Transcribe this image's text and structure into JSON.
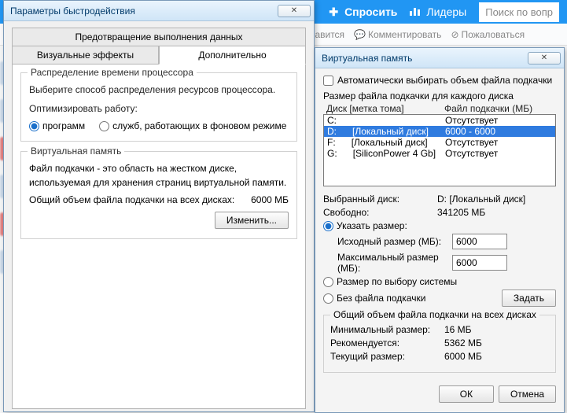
{
  "browser": {
    "ask": "Спросить",
    "leaders": "Лидеры",
    "search_placeholder": "Поиск по вопр"
  },
  "actions": {
    "like": "равится",
    "comment": "Комментировать",
    "report": "Пожаловаться"
  },
  "perf": {
    "title": "Параметры быстродействия",
    "tab_dep": "Предотвращение выполнения данных",
    "tab_vis": "Визуальные эффекты",
    "tab_adv": "Дополнительно",
    "cpu_group": "Распределение времени процессора",
    "cpu_desc": "Выберите способ распределения ресурсов процессора.",
    "opt_label": "Оптимизировать работу:",
    "radio_programs": "программ",
    "radio_services": "служб, работающих в фоновом режиме",
    "vm_group": "Виртуальная память",
    "vm_desc1": "Файл подкачки - это область на жестком диске,",
    "vm_desc2": "используемая для хранения страниц виртуальной памяти.",
    "vm_total_label": "Общий объем файла подкачки на всех дисках:",
    "vm_total_value": "6000 МБ",
    "change_btn": "Изменить..."
  },
  "vm": {
    "title": "Виртуальная память",
    "auto_chk": "Автоматически выбирать объем файла подкачки",
    "per_drive_label": "Размер файла подкачки для каждого диска",
    "col_drive": "Диск [метка тома]",
    "col_pf": "Файл подкачки (МБ)",
    "drives": [
      {
        "letter": "C:",
        "label": "",
        "pf": "Отсутствует",
        "selected": false
      },
      {
        "letter": "D:",
        "label": "[Локальный диск]",
        "pf": "6000 - 6000",
        "selected": true
      },
      {
        "letter": "F:",
        "label": "[Локальный диск]",
        "pf": "Отсутствует",
        "selected": false
      },
      {
        "letter": "G:",
        "label": "[SiliconPower 4 Gb]",
        "pf": "Отсутствует",
        "selected": false
      }
    ],
    "sel_drive_label": "Выбранный диск:",
    "sel_drive_value": "D:   [Локальный диск]",
    "free_label": "Свободно:",
    "free_value": "341205 МБ",
    "radio_custom": "Указать размер:",
    "init_label": "Исходный размер (МБ):",
    "init_value": "6000",
    "max_label": "Максимальный размер (МБ):",
    "max_value": "6000",
    "radio_system": "Размер по выбору системы",
    "radio_none": "Без файла подкачки",
    "set_btn": "Задать",
    "total_group": "Общий объем файла подкачки на всех дисках",
    "min_label": "Минимальный размер:",
    "min_value": "16 МБ",
    "rec_label": "Рекомендуется:",
    "rec_value": "5362 МБ",
    "cur_label": "Текущий размер:",
    "cur_value": "6000 МБ",
    "ok": "ОК",
    "cancel": "Отмена"
  }
}
